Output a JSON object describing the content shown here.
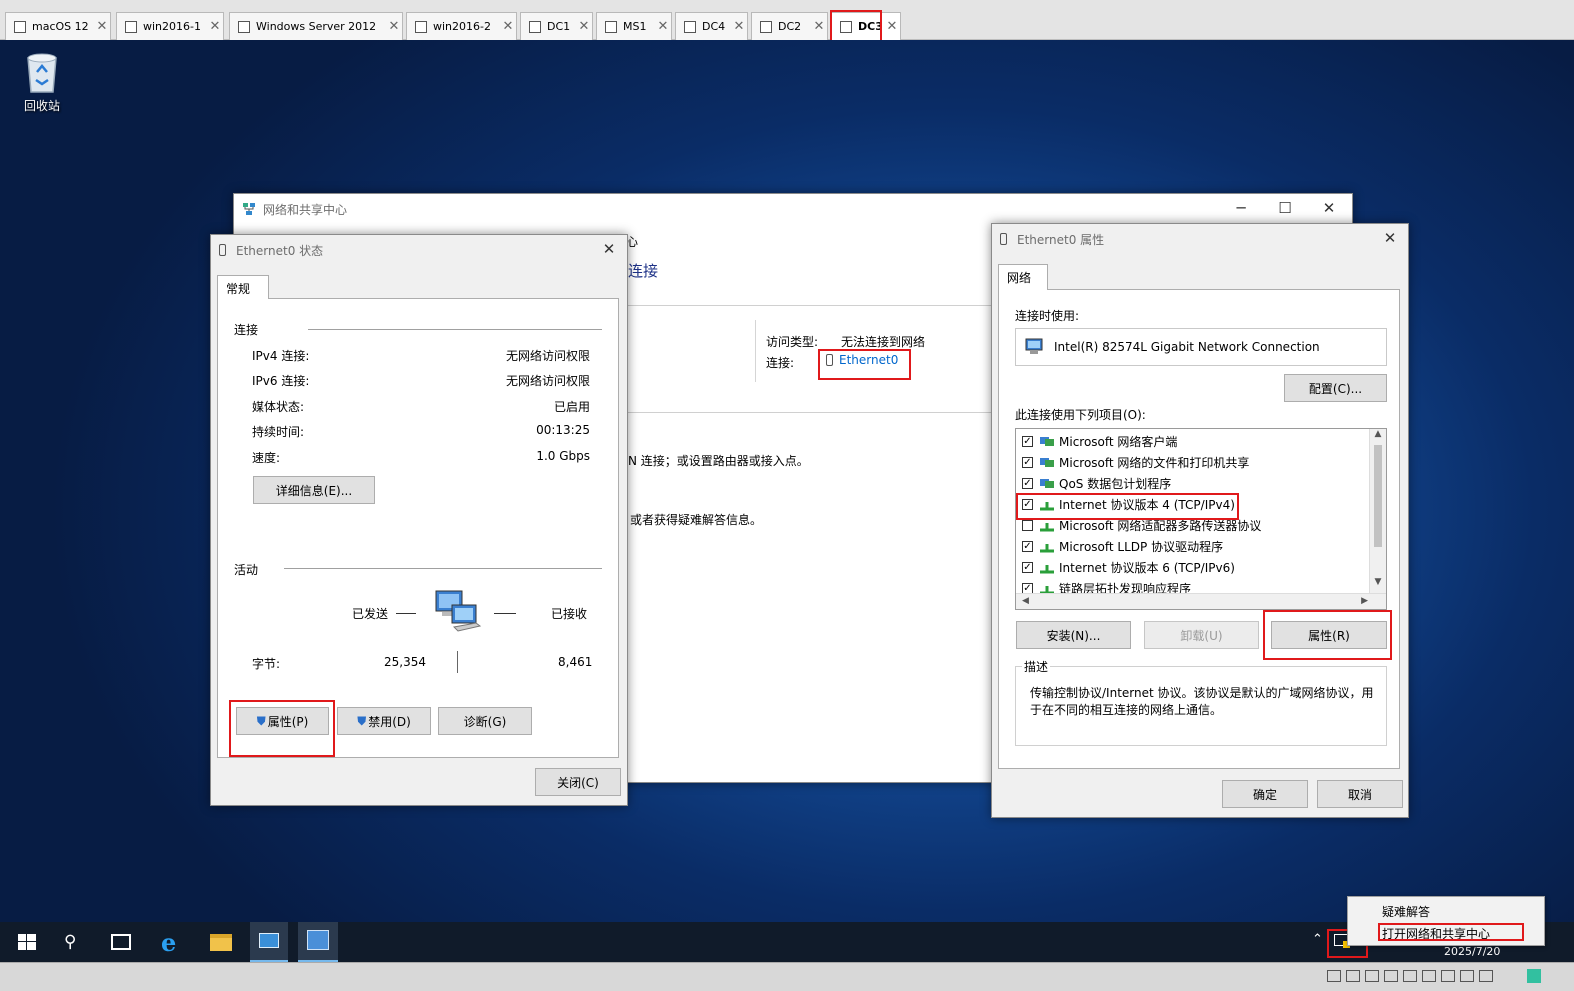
{
  "vm_tabs": [
    "macOS 12",
    "win2016-1",
    "Windows Server 2012",
    "win2016-2",
    "DC1",
    "MS1",
    "DC4",
    "DC2",
    "DC3"
  ],
  "desktop": {
    "recycle_bin_label": "回收站"
  },
  "nsc": {
    "title": "网络和共享中心",
    "breadcrumb_fragment": "心",
    "heading_fragment": "连接",
    "access_type_label": "访问类型:",
    "access_type_value": "无法连接到网络",
    "connection_label": "连接:",
    "connection_value": "Ethernet0",
    "text1": "N 连接；或设置路由器或接入点。",
    "text2": "或者获得疑难解答信息。"
  },
  "status_dialog": {
    "title": "Ethernet0 状态",
    "tab": "常规",
    "connection_header": "连接",
    "rows": [
      {
        "label": "IPv4 连接:",
        "value": "无网络访问权限"
      },
      {
        "label": "IPv6 连接:",
        "value": "无网络访问权限"
      },
      {
        "label": "媒体状态:",
        "value": "已启用"
      },
      {
        "label": "持续时间:",
        "value": "00:13:25"
      },
      {
        "label": "速度:",
        "value": "1.0 Gbps"
      }
    ],
    "details_button": "详细信息(E)...",
    "activity_header": "活动",
    "sent_label": "已发送",
    "received_label": "已接收",
    "bytes_label": "字节:",
    "bytes_sent": "25,354",
    "bytes_received": "8,461",
    "properties_button": "属性(P)",
    "disable_button": "禁用(D)",
    "diagnose_button": "诊断(G)",
    "close_button": "关闭(C)"
  },
  "props_dialog": {
    "title": "Ethernet0 属性",
    "tab": "网络",
    "connect_using_label": "连接时使用:",
    "adapter": "Intel(R) 82574L Gigabit Network Connection",
    "configure_button": "配置(C)...",
    "items_label": "此连接使用下列项目(O):",
    "items": [
      {
        "name": "Microsoft 网络客户端",
        "checked": true
      },
      {
        "name": "Microsoft 网络的文件和打印机共享",
        "checked": true
      },
      {
        "name": "QoS 数据包计划程序",
        "checked": true
      },
      {
        "name": "Internet 协议版本 4 (TCP/IPv4)",
        "checked": true
      },
      {
        "name": "Microsoft 网络适配器多路传送器协议",
        "checked": false
      },
      {
        "name": "Microsoft LLDP 协议驱动程序",
        "checked": true
      },
      {
        "name": "Internet 协议版本 6 (TCP/IPv6)",
        "checked": true
      },
      {
        "name": "链路层拓扑发现响应程序",
        "checked": true
      }
    ],
    "install_button": "安装(N)...",
    "uninstall_button": "卸载(U)",
    "properties_button": "属性(R)",
    "description_label": "描述",
    "description": "传输控制协议/Internet 协议。该协议是默认的广域网络协议，用于在不同的相互连接的网络上通信。",
    "ok_button": "确定",
    "cancel_button": "取消"
  },
  "context_menu": {
    "items": [
      "疑难解答",
      "打开网络和共享中心"
    ]
  },
  "taskbar": {
    "date": "2025/7/20"
  },
  "colors": {
    "highlight": "#e0191b",
    "link": "#0066cc"
  }
}
